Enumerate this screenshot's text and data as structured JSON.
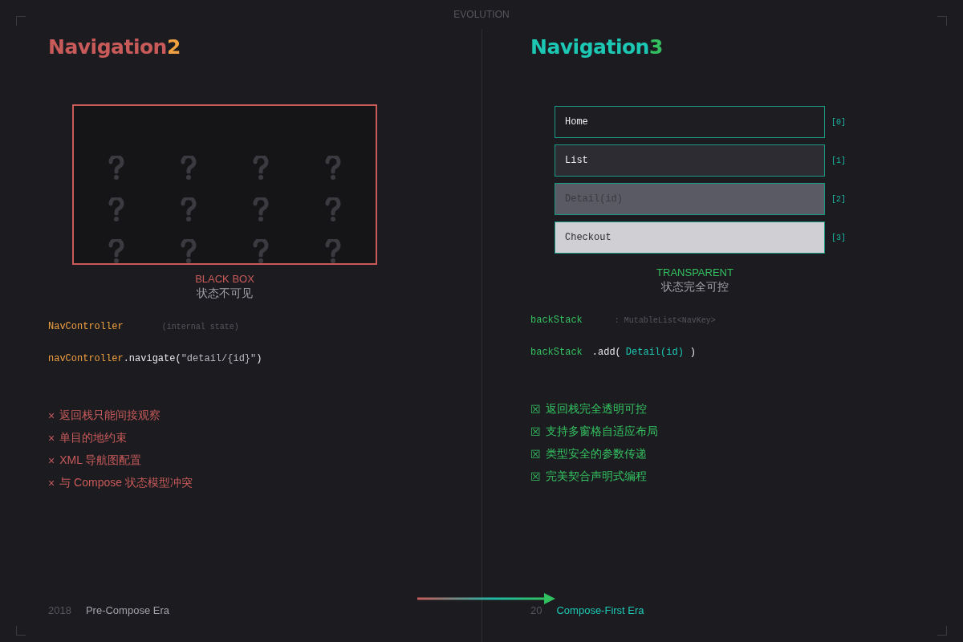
{
  "header": {
    "title": "EVOLUTION"
  },
  "left": {
    "title": {
      "name": "Navigation",
      "version": "2"
    },
    "black_box": {
      "caption": "BLACK BOX",
      "subtitle": "状态不可见"
    },
    "code": [
      {
        "tokens": [
          {
            "text": "NavController",
            "kind": "name"
          },
          {
            "text": "(internal state)",
            "kind": "comment"
          }
        ]
      },
      {
        "tokens": [
          {
            "text": "navController",
            "kind": "name"
          },
          {
            "text": ".navigate(",
            "kind": "plain"
          },
          {
            "text": "\"detail/{id}\"",
            "kind": "string"
          },
          {
            "text": ")",
            "kind": "plain"
          }
        ]
      }
    ],
    "points": [
      {
        "marker": "×",
        "text": "返回栈只能间接观察"
      },
      {
        "marker": "×",
        "text": "单目的地约束"
      },
      {
        "marker": "×",
        "text": "XML 导航图配置"
      },
      {
        "marker": "×",
        "text": "与 Compose 状态模型冲突"
      }
    ],
    "footer": {
      "year": "2018",
      "era": "Pre-Compose Era"
    }
  },
  "right": {
    "title": {
      "name": "Navigation",
      "version": "3"
    },
    "back_stack": [
      {
        "label": "Home",
        "index": "[0]",
        "color": "#1e1e22"
      },
      {
        "label": "List",
        "index": "[1]",
        "color": "#2c2c32"
      },
      {
        "label": "Detail(id)",
        "index": "[2]",
        "color": "#5a5a64"
      },
      {
        "label": "Checkout",
        "index": "[3]",
        "color": "#d0d0d4"
      }
    ],
    "caption": "TRANSPARENT",
    "subtitle": "状态完全可控",
    "code": [
      {
        "tokens": [
          {
            "text": "backStack",
            "kind": "name"
          },
          {
            "text": ": MutableList<NavKey>",
            "kind": "comment"
          }
        ]
      },
      {
        "tokens": [
          {
            "text": "backStack",
            "kind": "name"
          },
          {
            "text": ".add(",
            "kind": "plain"
          },
          {
            "text": "Detail(id)",
            "kind": "type"
          },
          {
            "text": ")",
            "kind": "plain"
          }
        ]
      }
    ],
    "points": [
      {
        "marker": "☒",
        "text": "返回栈完全透明可控"
      },
      {
        "marker": "☒",
        "text": "支持多窗格自适应布局"
      },
      {
        "marker": "☒",
        "text": "类型安全的参数传递"
      },
      {
        "marker": "☒",
        "text": "完美契合声明式编程"
      }
    ],
    "footer": {
      "year": "20",
      "era": "Compose-First Era"
    }
  }
}
